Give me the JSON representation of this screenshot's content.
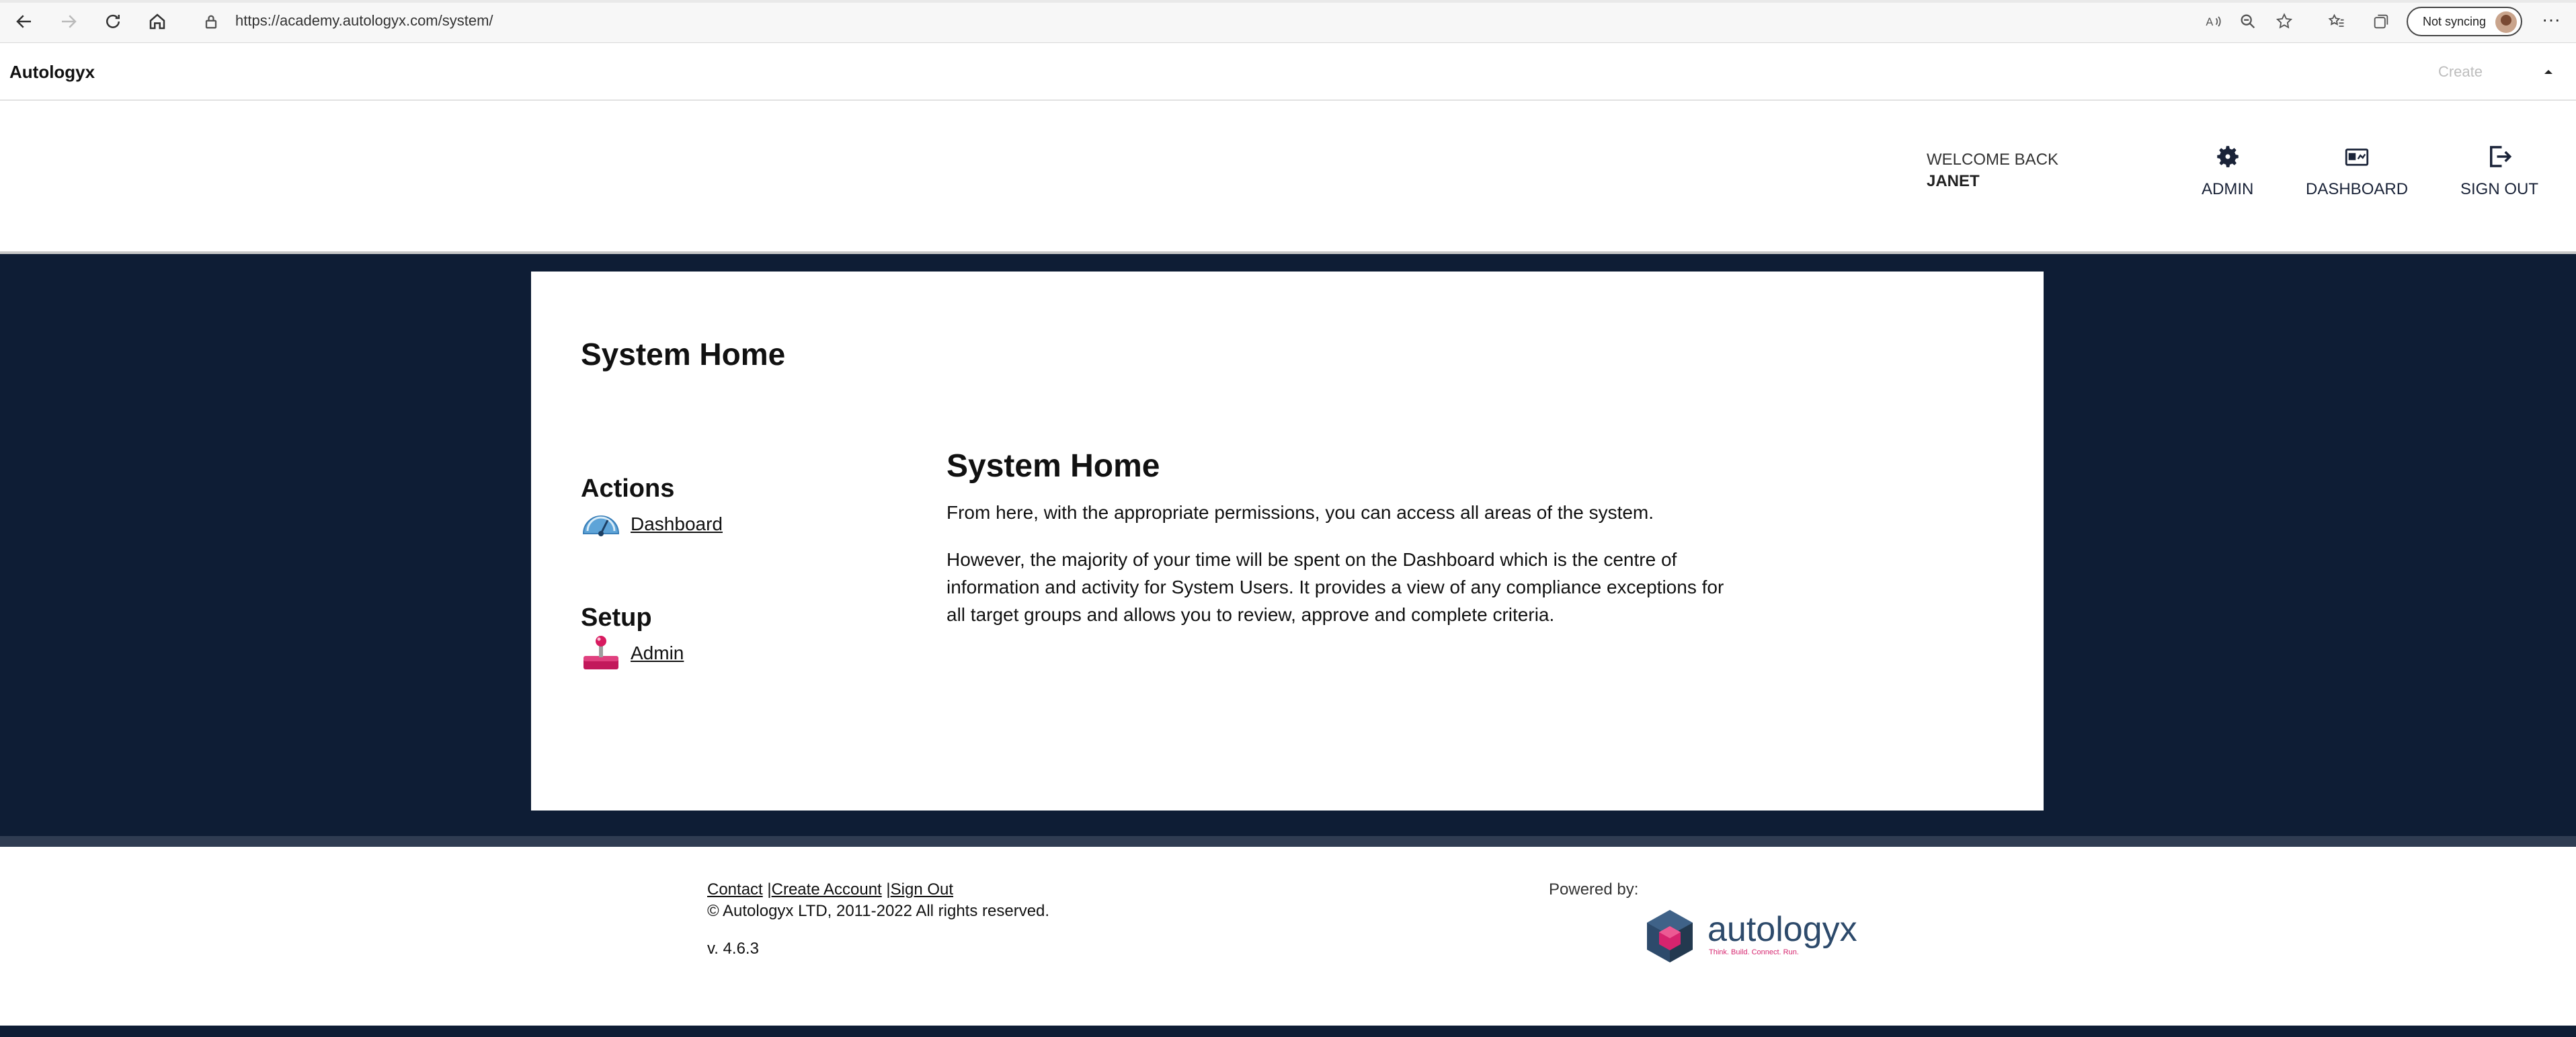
{
  "browser": {
    "url": "https://academy.autologyx.com/system/",
    "sync_label": "Not syncing",
    "icons": [
      "back-icon",
      "forward-icon",
      "reload-icon",
      "home-icon",
      "lock-icon",
      "read-aloud-icon",
      "zoom-icon",
      "add-favorite-icon",
      "favorites-icon",
      "collections-icon",
      "more-icon"
    ]
  },
  "header": {
    "brand": "Autologyx",
    "create_label": "Create"
  },
  "user_bar": {
    "welcome": "WELCOME BACK",
    "user_name": "JANET",
    "nav": [
      {
        "label": "ADMIN",
        "icon": "gear-icon"
      },
      {
        "label": "DASHBOARD",
        "icon": "dashboard-icon"
      },
      {
        "label": "SIGN OUT",
        "icon": "sign-out-icon"
      }
    ]
  },
  "page": {
    "title": "System Home",
    "actions_heading": "Actions",
    "actions": [
      {
        "label": "Dashboard",
        "icon": "speedometer-icon"
      }
    ],
    "setup_heading": "Setup",
    "setup": [
      {
        "label": "Admin",
        "icon": "joystick-icon"
      }
    ],
    "content_title": "System Home",
    "paragraphs": [
      "From here, with the appropriate permissions, you can access all areas of the system.",
      "However, the majority of your time will be spent on the Dashboard which is the centre of information and activity for System Users. It provides a view of any compliance exceptions for all target groups and allows you to review, approve and complete criteria."
    ]
  },
  "footer": {
    "links": [
      "Contact",
      "Create Account",
      "Sign Out"
    ],
    "copyright": "© Autologyx LTD, 2011-2022 All rights reserved.",
    "version": "v. 4.6.3",
    "powered_by": "Powered by:",
    "logo_text": "autologyx",
    "logo_tagline": "Think. Build. Connect. Run."
  },
  "colors": {
    "band": "#0e1d35",
    "nav_text": "#1a2338",
    "logo_blue": "#2d4a6b",
    "logo_pink": "#d6246e"
  }
}
